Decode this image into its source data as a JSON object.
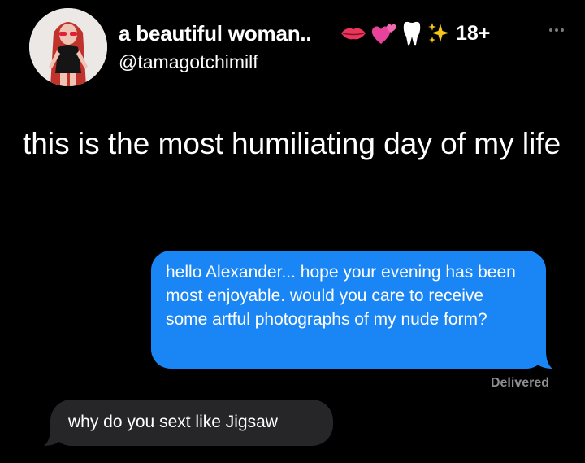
{
  "header": {
    "display_name": "a beautiful woman..",
    "badge": "18+",
    "handle": "@tamagotchimilf",
    "emojis": [
      "lips-icon",
      "two-hearts-icon",
      "tooth-icon",
      "sparkles-icon"
    ]
  },
  "tweet": {
    "text": "this is the most humiliating day of my life"
  },
  "messages": {
    "outgoing": "hello Alexander... hope your evening has been most enjoyable. would you care to receive some artful photographs of my nude form?",
    "status": "Delivered",
    "incoming": "why do you sext like Jigsaw"
  },
  "colors": {
    "background": "#000000",
    "outgoing_bubble": "#1a86f5",
    "incoming_bubble": "#262628",
    "delivered_text": "#8e8e93"
  }
}
